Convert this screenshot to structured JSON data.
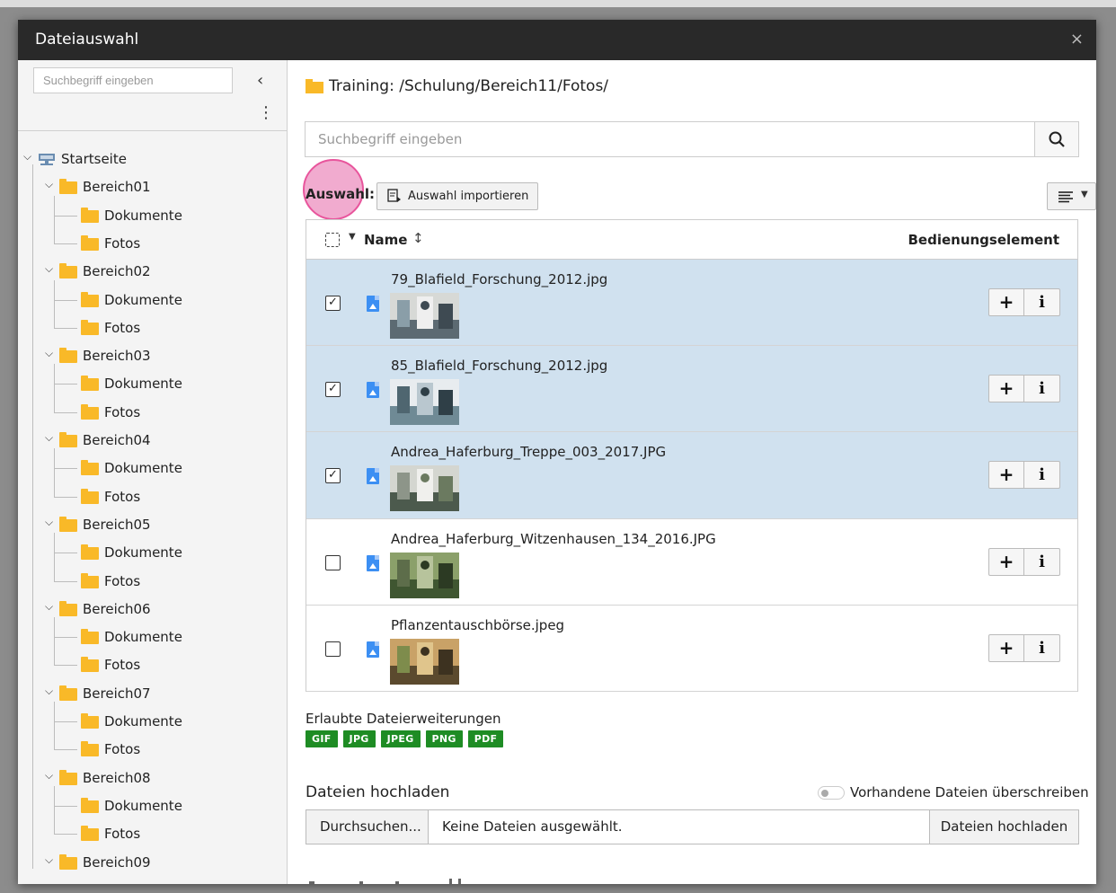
{
  "modal": {
    "title": "Dateiauswahl",
    "close_symbol": "×"
  },
  "sidebar": {
    "search_placeholder": "Suchbegriff eingeben",
    "collapse_symbol": "‹",
    "menu_symbol": "⋮",
    "root_label": "Startseite",
    "areas": [
      {
        "label": "Bereich01",
        "children": [
          "Dokumente",
          "Fotos"
        ]
      },
      {
        "label": "Bereich02",
        "children": [
          "Dokumente",
          "Fotos"
        ]
      },
      {
        "label": "Bereich03",
        "children": [
          "Dokumente",
          "Fotos"
        ]
      },
      {
        "label": "Bereich04",
        "children": [
          "Dokumente",
          "Fotos"
        ]
      },
      {
        "label": "Bereich05",
        "children": [
          "Dokumente",
          "Fotos"
        ]
      },
      {
        "label": "Bereich06",
        "children": [
          "Dokumente",
          "Fotos"
        ]
      },
      {
        "label": "Bereich07",
        "children": [
          "Dokumente",
          "Fotos"
        ]
      },
      {
        "label": "Bereich08",
        "children": [
          "Dokumente",
          "Fotos"
        ]
      },
      {
        "label": "Bereich09",
        "children": []
      }
    ]
  },
  "main": {
    "path": "Training: /Schulung/Bereich11/Fotos/",
    "search_placeholder": "Suchbegriff eingeben",
    "selection_label": "Auswahl:",
    "import_button": "Auswahl importieren",
    "table": {
      "col_name": "Name",
      "col_controls": "Bedienungselement",
      "sort_symbol": "↕",
      "rows": [
        {
          "filename": "79_Blafield_Forschung_2012.jpg",
          "selected": true,
          "check": "✓"
        },
        {
          "filename": "85_Blafield_Forschung_2012.jpg",
          "selected": true,
          "check": "✓"
        },
        {
          "filename": "Andrea_Haferburg_Treppe_003_2017.JPG",
          "selected": true,
          "check": "✓"
        },
        {
          "filename": "Andrea_Haferburg_Witzenhausen_134_2016.JPG",
          "selected": false,
          "check": ""
        },
        {
          "filename": "Pflanzentauschbörse.jpeg",
          "selected": false,
          "check": ""
        }
      ],
      "add_symbol": "+",
      "info_symbol": "i"
    },
    "extensions_label": "Erlaubte Dateierweiterungen",
    "extensions": [
      "GIF",
      "JPG",
      "JPEG",
      "PNG",
      "PDF"
    ],
    "extension_color": "#1e8c24",
    "upload": {
      "title": "Dateien hochladen",
      "overwrite_label": "Vorhandene Dateien überschreiben",
      "overwrite_enabled": false,
      "browse_button": "Durchsuchen...",
      "no_file_text": "Keine Dateien ausgewählt.",
      "upload_button": "Dateien hochladen"
    }
  },
  "colors": {
    "header_bg": "#292929",
    "selected_row_bg": "#d0e1ef",
    "folder": "#f9b928",
    "file_icon": "#3c8ff3",
    "highlight": "#e8559c"
  }
}
